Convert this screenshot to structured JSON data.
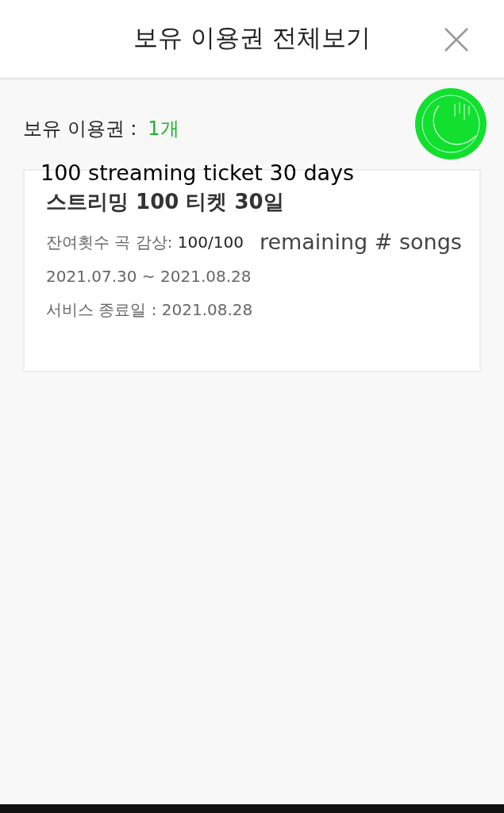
{
  "header": {
    "title": "보유 이용권 전체보기"
  },
  "summary": {
    "label": "보유 이용권 :",
    "count": "1개"
  },
  "annotations": [
    {
      "kind": "title",
      "text": "100 streaming ticket  30 days"
    },
    {
      "kind": "remaining",
      "text": "remaining #  songs"
    }
  ],
  "tickets": [
    {
      "name": "스트리밍 100 티켓 30일",
      "remaining_label": "잔여횟수 곡 감상:",
      "remaining_value": "100/100",
      "period": "2021.07.30 ~ 2021.08.28",
      "end_date": "서비스 종료일 : 2021.08.28"
    }
  ]
}
